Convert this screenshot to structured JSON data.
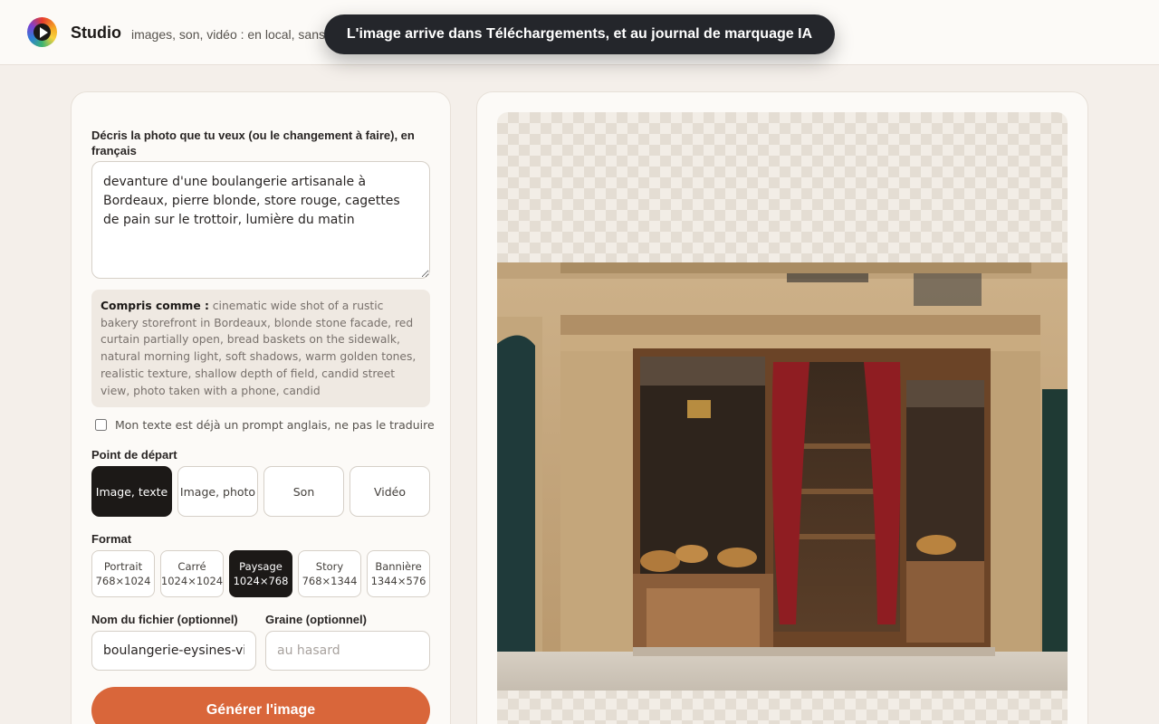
{
  "header": {
    "brand": "Studio",
    "tagline": "images, son, vidéo : en local, sans"
  },
  "toast": {
    "message": "L'image arrive dans Téléchargements, et au journal de marquage IA"
  },
  "form": {
    "prompt_label": "Décris la photo que tu veux (ou le changement à faire), en français",
    "prompt_value": "devanture d'une boulangerie artisanale à Bordeaux, pierre blonde, store rouge, cagettes de pain sur le trottoir, lumière du matin",
    "understood_label": "Compris comme :",
    "understood_text": " cinematic wide shot of a rustic bakery storefront in Bordeaux, blonde stone facade, red curtain partially open, bread baskets on the sidewalk, natural morning light, soft shadows, warm golden tones, realistic texture, shallow depth of field, candid street view, photo taken with a phone, candid",
    "no_translate_label": "Mon texte est déjà un prompt anglais, ne pas le traduire",
    "no_translate_checked": false,
    "start_label": "Point de départ",
    "start_options": [
      {
        "label": "Image, texte",
        "active": true
      },
      {
        "label": "Image, photo",
        "active": false
      },
      {
        "label": "Son",
        "active": false
      },
      {
        "label": "Vidéo",
        "active": false
      }
    ],
    "format_label": "Format",
    "formats": [
      {
        "name": "Portrait",
        "size": "768×1024",
        "active": false
      },
      {
        "name": "Carré",
        "size": "1024×1024",
        "active": false
      },
      {
        "name": "Paysage",
        "size": "1024×768",
        "active": true
      },
      {
        "name": "Story",
        "size": "768×1344",
        "active": false
      },
      {
        "name": "Bannière",
        "size": "1344×576",
        "active": false
      }
    ],
    "filename_label": "Nom du fichier (optionnel)",
    "filename_value": "boulangerie-eysines-vitrine",
    "seed_label": "Graine (optionnel)",
    "seed_placeholder": "au hasard",
    "generate_label": "Générer l'image"
  },
  "colors": {
    "accent": "#d9663a",
    "dark": "#1c1917",
    "background": "#f4efea"
  }
}
